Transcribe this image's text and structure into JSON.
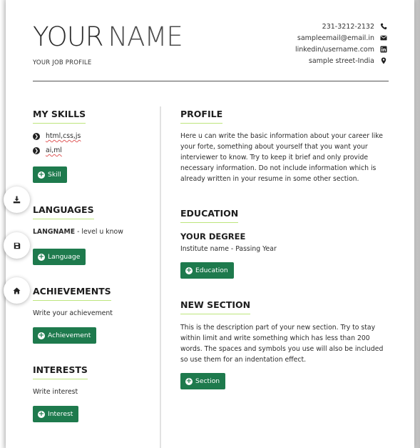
{
  "header": {
    "first_name": "YOUR",
    "last_name": "NAME",
    "job_profile": "YOUR JOB PROFILE"
  },
  "contact": [
    {
      "text": "231-3212-2132",
      "icon": "phone-icon"
    },
    {
      "text": "sampleemail@email.in",
      "icon": "envelope-icon"
    },
    {
      "text": "linkedin/username.com",
      "icon": "linkedin-icon"
    },
    {
      "text": "sample street-India",
      "icon": "map-marker-icon"
    }
  ],
  "left": {
    "skills": {
      "title": "MY SKILLS",
      "items": [
        "html,css,js",
        "ai,ml"
      ],
      "button": "Skill"
    },
    "languages": {
      "title": "LANGUAGES",
      "lang_name": "LANGNAME",
      "level": " - level u know",
      "button": "Language"
    },
    "achievements": {
      "title": "ACHIEVEMENTS",
      "text": "Write your achievement",
      "button": "Achievement"
    },
    "interests": {
      "title": "INTERESTS",
      "text": "Write interest",
      "button": "Interest"
    }
  },
  "right": {
    "profile": {
      "title": "PROFILE",
      "text": "Here u can write the basic information about your career like your forte, something about yourself that you want your interviewer to know. Try to keep it brief and only provide necessary information. Do not include information which is already written in your resume in some other section."
    },
    "education": {
      "title": "EDUCATION",
      "degree": "YOUR DEGREE",
      "institute": "Institute name - Passing Year",
      "button": "Education"
    },
    "new_section": {
      "title": "NEW SECTION",
      "text": "This is the description part of your new section. Try to stay within limit and write something which has less than 200 words. The spaces and symbols you use will also be included so use them for an indentation effect.",
      "button": "Section"
    }
  },
  "fabs": [
    {
      "icon": "download-icon"
    },
    {
      "icon": "save-icon"
    },
    {
      "icon": "home-icon"
    }
  ],
  "colors": {
    "accent_button": "#1e7a4d",
    "heading_underline": "#bde67d",
    "text": "#2c2c2c"
  }
}
